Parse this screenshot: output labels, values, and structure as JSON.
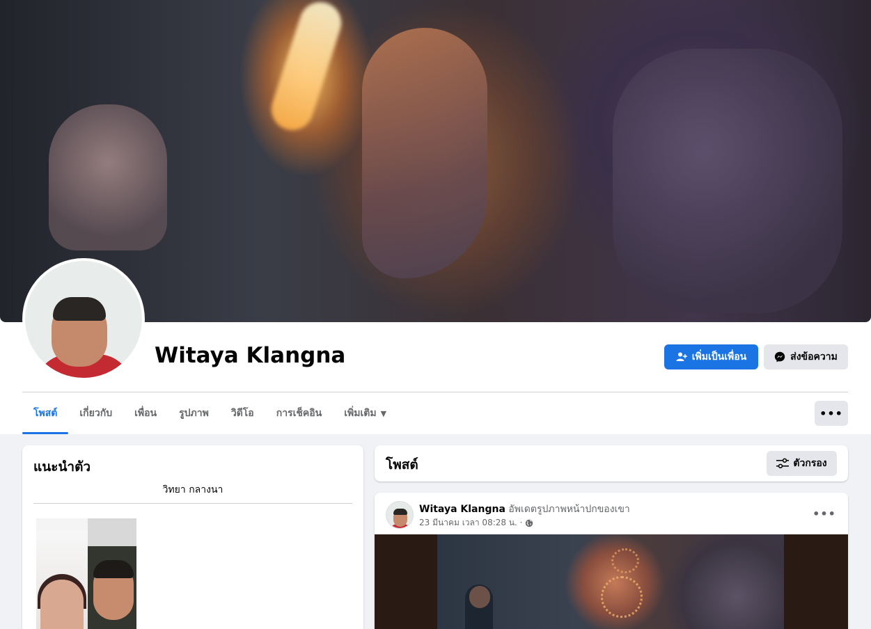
{
  "profile": {
    "name": "Witaya Klangna",
    "add_friend_label": "เพิ่มเป็นเพื่อน",
    "message_label": "ส่งข้อความ"
  },
  "tabs": [
    {
      "label": "โพสต์",
      "active": true
    },
    {
      "label": "เกี่ยวกับ",
      "active": false
    },
    {
      "label": "เพื่อน",
      "active": false
    },
    {
      "label": "รูปภาพ",
      "active": false
    },
    {
      "label": "วิดีโอ",
      "active": false
    },
    {
      "label": "การเช็คอิน",
      "active": false
    },
    {
      "label": "เพิ่มเติม",
      "active": false
    }
  ],
  "intro": {
    "title": "แนะนำตัว",
    "bio": "วิทยา กลางนา"
  },
  "posts": {
    "title": "โพสต์",
    "filter_label": "ตัวกรอง"
  },
  "post": {
    "author": "Witaya Klangna",
    "action": "อัพเดตรูปภาพหน้าปกของเขา",
    "timestamp": "23 มีนาคม เวลา 08:28 น. ·",
    "privacy_icon": "globe-icon"
  },
  "colors": {
    "accent": "#1b74e4",
    "background": "#f0f2f5",
    "secondary_button": "#e4e6eb"
  }
}
